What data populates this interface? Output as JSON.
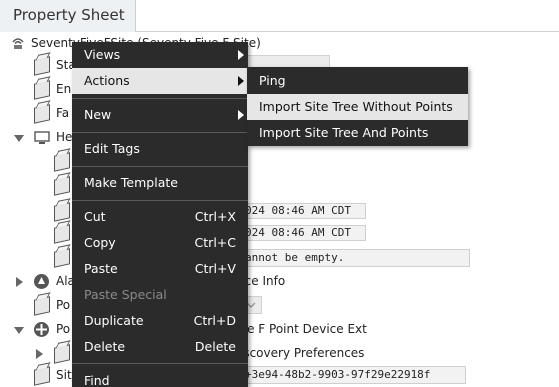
{
  "tab": {
    "title": "Property Sheet"
  },
  "tree": {
    "root_label": "SeventyFiveFSite  (Seventy Five F Site)",
    "rows": [
      {
        "label": "Sta"
      },
      {
        "label": "En"
      },
      {
        "label": "Fa"
      },
      {
        "label": "He"
      }
    ],
    "timestamp1": "024 08:46 AM CDT",
    "timestamp2": "024 08:46 AM CDT",
    "error_text": "annot be empty.",
    "alarm_label": "Ala",
    "alarm_value": "rce Info",
    "po1_label": "Po",
    "po2_label": "Po",
    "po2_value": "ve F Point Device Ext",
    "discovery_value": "iscovery Preferences",
    "site_label": "Sit",
    "site_value": "+3e94-48b2-9903-97f29e22918f"
  },
  "context_menu": {
    "items": [
      {
        "label": "Views",
        "submenu": true
      },
      {
        "label": "Actions",
        "submenu": true,
        "selected": true
      },
      {
        "label": "New",
        "submenu": true
      },
      {
        "label": "Edit Tags"
      },
      {
        "label": "Make Template"
      },
      {
        "label": "Cut",
        "shortcut": "Ctrl+X"
      },
      {
        "label": "Copy",
        "shortcut": "Ctrl+C"
      },
      {
        "label": "Paste",
        "shortcut": "Ctrl+V"
      },
      {
        "label": "Paste Special",
        "disabled": true
      },
      {
        "label": "Duplicate",
        "shortcut": "Ctrl+D"
      },
      {
        "label": "Delete",
        "shortcut": "Delete"
      },
      {
        "label": "Find"
      }
    ]
  },
  "actions_submenu": {
    "items": [
      {
        "label": "Ping"
      },
      {
        "label": "Import Site Tree Without Points",
        "selected": true
      },
      {
        "label": "Import Site Tree And Points"
      }
    ]
  },
  "colors": {
    "menu_bg": "#2b2b2b",
    "menu_selected": "#e6e6e6",
    "tab_bg": "#eef1f4"
  }
}
